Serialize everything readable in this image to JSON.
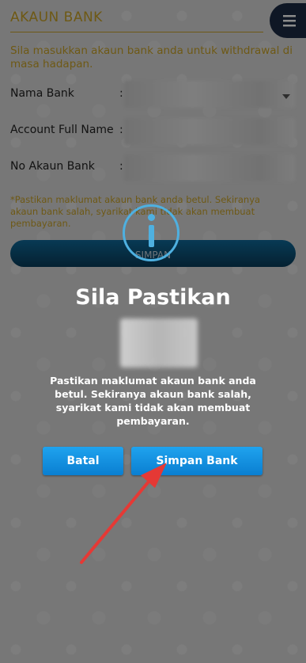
{
  "page": {
    "title": "AKAUN BANK",
    "subtitle": "Sila masukkan akaun bank anda untuk withdrawal di masa hadapan.",
    "fields": [
      {
        "label": "Nama Bank",
        "colon": ":"
      },
      {
        "label": "Account Full Name",
        "colon": ":"
      },
      {
        "label": "No Akaun Bank",
        "colon": ":"
      }
    ],
    "note": "*Pastikan maklumat akaun bank anda betul. Sekiranya akaun bank salah, syarikat kami tidak akan membuat pembayaran.",
    "simpan_label": "SIMPAN"
  },
  "modal": {
    "title": "Sila Pastikan",
    "message": "Pastikan maklumat akaun bank anda betul. Sekiranya akaun bank salah, syarikat kami tidak akan membuat pembayaran.",
    "cancel_label": "Batal",
    "confirm_label": "Simpan Bank"
  },
  "icons": {
    "menu": "hamburger-menu-icon",
    "info": "info-icon",
    "annotation": "red-arrow-pointer"
  },
  "colors": {
    "accent": "#c9a227",
    "button": "#1fa3ee",
    "menu_bg": "#1c2b44",
    "info": "#4eb0e0",
    "annotation": "#e53935"
  }
}
